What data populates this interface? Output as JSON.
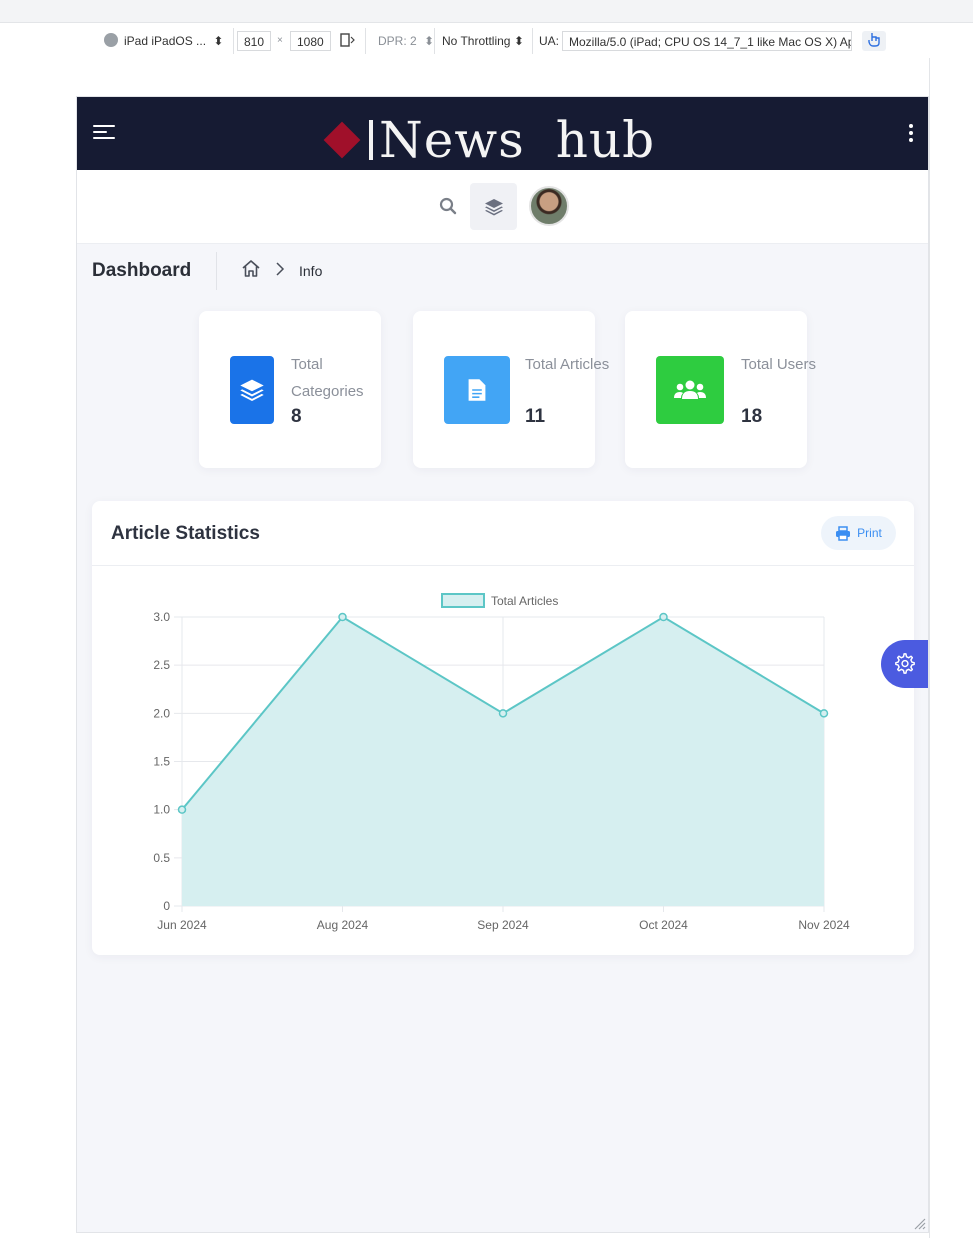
{
  "devtools": {
    "device": "iPad iPadOS ...",
    "width": "810",
    "times": "×",
    "height": "1080",
    "dpr": "DPR: 2",
    "throttling": "No Throttling",
    "ua_label": "UA:",
    "ua_value": "Mozilla/5.0 (iPad; CPU OS 14_7_1 like Mac OS X) Ap"
  },
  "header": {
    "logo_text": "News hub"
  },
  "breadcrumb": {
    "title": "Dashboard",
    "current": "Info"
  },
  "stats": [
    {
      "label": "Total Categories",
      "value": "8",
      "color": "#1a73e8"
    },
    {
      "label": "Total Articles",
      "value": "11",
      "color": "#42a5f5"
    },
    {
      "label": "Total Users",
      "value": "18",
      "color": "#2ecc40"
    }
  ],
  "chart_card": {
    "title": "Article Statistics",
    "print_label": "Print"
  },
  "chart_data": {
    "type": "area",
    "categories": [
      "Jun 2024",
      "Aug 2024",
      "Sep 2024",
      "Oct 2024",
      "Nov 2024"
    ],
    "series": [
      {
        "name": "Total Articles",
        "values": [
          1,
          3,
          2,
          3,
          2
        ]
      }
    ],
    "yticks": [
      "0",
      "0.5",
      "1.0",
      "1.5",
      "2.0",
      "2.5",
      "3.0"
    ],
    "ylim": [
      0,
      3
    ],
    "grid": true,
    "legend": "top",
    "line_color": "#5cc6c6",
    "fill_color": "#d6eff0"
  }
}
